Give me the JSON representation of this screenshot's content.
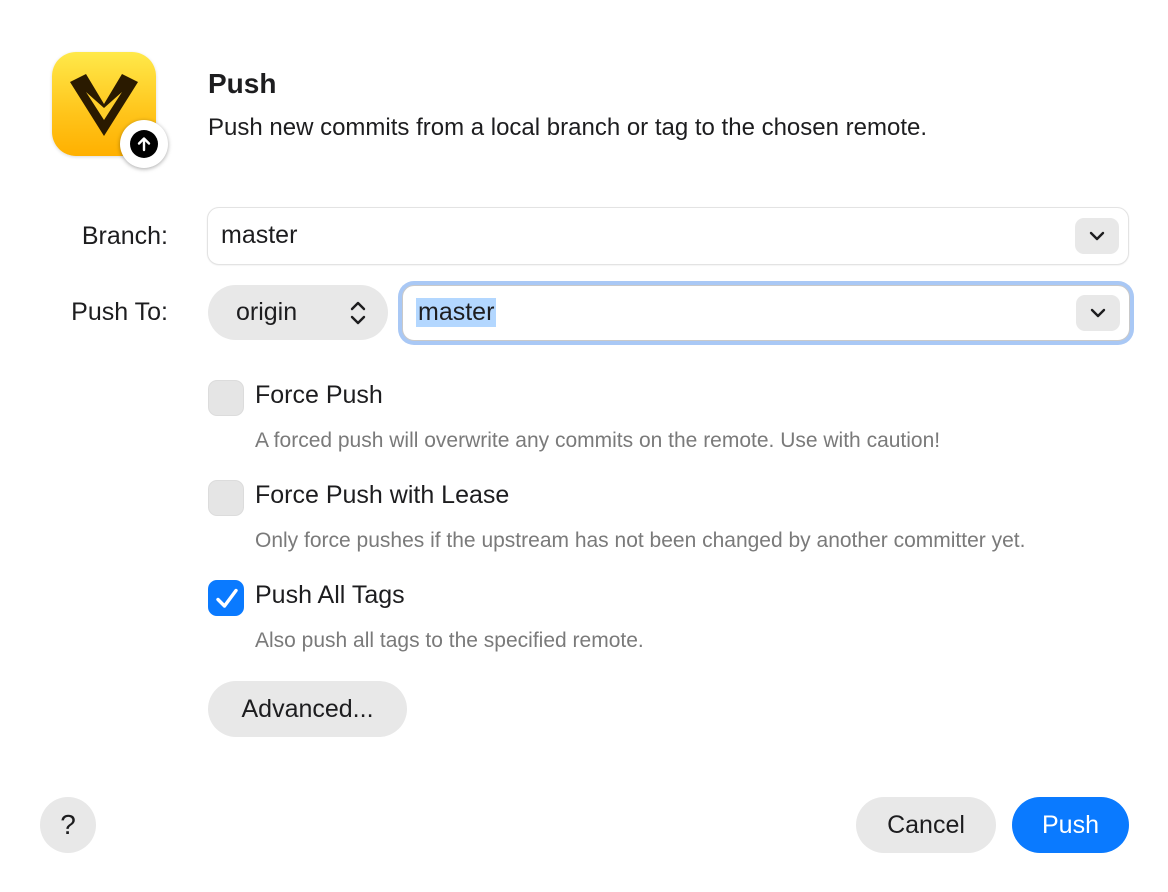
{
  "dialog": {
    "title": "Push",
    "subtitle": "Push new commits from a local branch or tag to the chosen remote."
  },
  "branch": {
    "label": "Branch:",
    "value": "master"
  },
  "push_to": {
    "label": "Push To:",
    "remote": "origin",
    "destination": "master"
  },
  "options": [
    {
      "label": "Force Push",
      "help": "A forced push will overwrite any commits on the remote. Use with caution!",
      "checked": false
    },
    {
      "label": "Force Push with Lease",
      "help": "Only force pushes if the upstream has not been changed by another committer yet.",
      "checked": false
    },
    {
      "label": "Push All Tags",
      "help": "Also push all tags to the specified remote.",
      "checked": true
    }
  ],
  "buttons": {
    "advanced": "Advanced...",
    "help": "?",
    "cancel": "Cancel",
    "push": "Push"
  },
  "colors": {
    "accent": "#0a7aff",
    "focus_ring": "#a9c8f5",
    "selection": "#b3d7ff",
    "app_icon": "#ffc41a"
  },
  "icons": {
    "app": "app-logo-icon",
    "badge": "arrow-up-circle-icon",
    "dropdown": "chevron-down-icon",
    "popup": "chevron-up-down-icon",
    "checked": "checkmark-icon"
  }
}
